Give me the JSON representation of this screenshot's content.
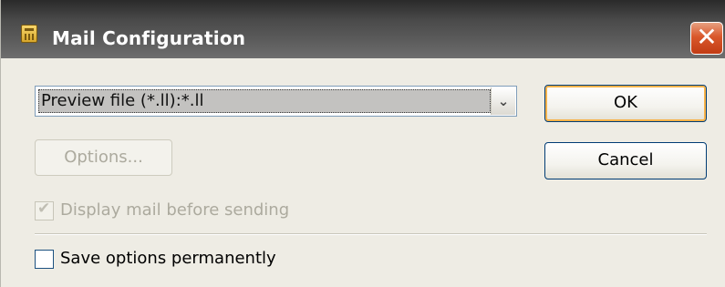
{
  "window": {
    "title": "Mail Configuration",
    "close_glyph": "✕",
    "title_icon": "calculator-icon"
  },
  "format_select": {
    "selected_value": "Preview file (*.ll):*.ll"
  },
  "buttons": {
    "ok_label": "OK",
    "cancel_label": "Cancel",
    "options_label": "Options...",
    "options_enabled": false
  },
  "checkboxes": {
    "display_mail": {
      "label": "Display mail before sending",
      "checked": true,
      "enabled": false
    },
    "save_options": {
      "label": "Save options permanently",
      "checked": false,
      "enabled": true
    }
  },
  "colors": {
    "titlebar": "#4a4a4a",
    "close_button": "#d9582c",
    "default_button_focus": "#f8b34a",
    "dialog_background": "#eeece4"
  }
}
